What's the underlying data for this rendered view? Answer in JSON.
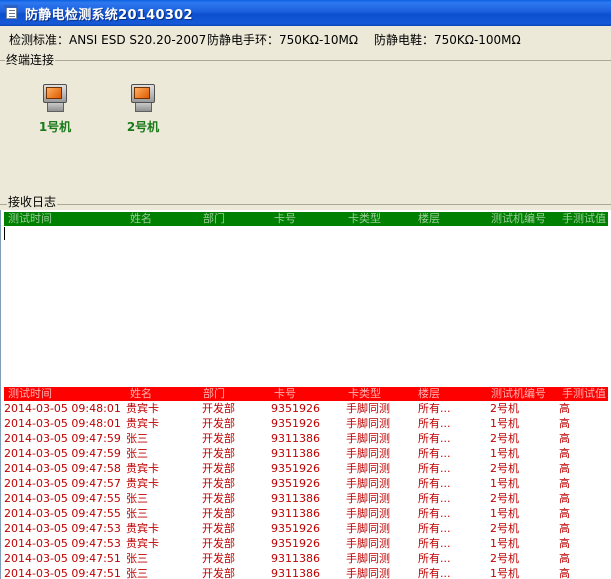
{
  "window": {
    "title": "防静电检测系统20140302"
  },
  "info": {
    "standard": "检测标准：ANSI ESD S20.20-2007",
    "wrist_strap": "防静电手环：750KΩ-10MΩ",
    "shoes": "防静电鞋：750KΩ-100MΩ"
  },
  "terminal_group": {
    "label": "终端连接",
    "terminals": [
      {
        "label": "1号机",
        "icon": "computer-icon"
      },
      {
        "label": "2号机",
        "icon": "computer-icon"
      }
    ]
  },
  "log": {
    "label": "接收日志",
    "columns": [
      "测试时间",
      "姓名",
      "部门",
      "卡号",
      "卡类型",
      "楼层",
      "测试机编号",
      "手测试值"
    ],
    "rows": [
      [
        "2014-03-05 09:48:01",
        "贵宾卡",
        "开发部",
        "9351926",
        "手脚同测",
        "所有...",
        "2号机",
        "高"
      ],
      [
        "2014-03-05 09:48:01",
        "贵宾卡",
        "开发部",
        "9351926",
        "手脚同测",
        "所有...",
        "1号机",
        "高"
      ],
      [
        "2014-03-05 09:47:59",
        "张三",
        "开发部",
        "9311386",
        "手脚同测",
        "所有...",
        "2号机",
        "高"
      ],
      [
        "2014-03-05 09:47:59",
        "张三",
        "开发部",
        "9311386",
        "手脚同测",
        "所有...",
        "1号机",
        "高"
      ],
      [
        "2014-03-05 09:47:58",
        "贵宾卡",
        "开发部",
        "9351926",
        "手脚同测",
        "所有...",
        "2号机",
        "高"
      ],
      [
        "2014-03-05 09:47:57",
        "贵宾卡",
        "开发部",
        "9351926",
        "手脚同测",
        "所有...",
        "1号机",
        "高"
      ],
      [
        "2014-03-05 09:47:55",
        "张三",
        "开发部",
        "9311386",
        "手脚同测",
        "所有...",
        "2号机",
        "高"
      ],
      [
        "2014-03-05 09:47:55",
        "张三",
        "开发部",
        "9311386",
        "手脚同测",
        "所有...",
        "1号机",
        "高"
      ],
      [
        "2014-03-05 09:47:53",
        "贵宾卡",
        "开发部",
        "9351926",
        "手脚同测",
        "所有...",
        "2号机",
        "高"
      ],
      [
        "2014-03-05 09:47:53",
        "贵宾卡",
        "开发部",
        "9351926",
        "手脚同测",
        "所有...",
        "1号机",
        "高"
      ],
      [
        "2014-03-05 09:47:51",
        "张三",
        "开发部",
        "9311386",
        "手脚同测",
        "所有...",
        "2号机",
        "高"
      ],
      [
        "2014-03-05 09:47:51",
        "张三",
        "开发部",
        "9311386",
        "手脚同测",
        "所有...",
        "1号机",
        "高"
      ]
    ]
  },
  "colors": {
    "title_bar": "#1c5fdd",
    "pending_header": "#008000",
    "result_header": "#ff0000",
    "result_text": "#c00000",
    "terminal_label": "#1a7a1a"
  }
}
